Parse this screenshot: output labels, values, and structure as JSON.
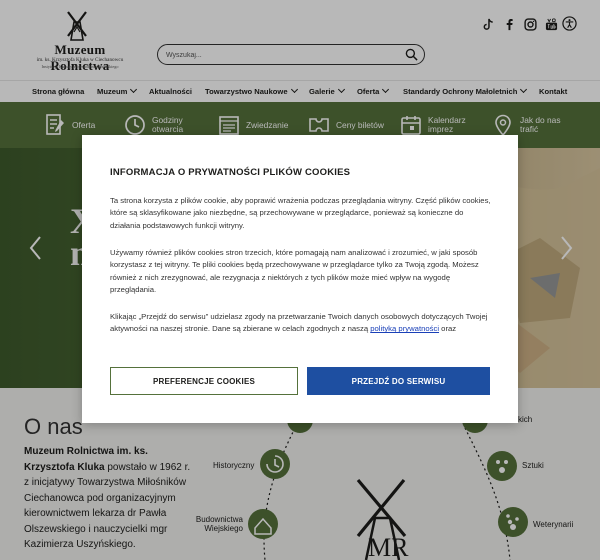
{
  "header": {
    "logo": {
      "title": "Muzeum Rolnictwa",
      "subtitle_line1": "im. ks. Krzysztofa Kluka w Ciechanowcu",
      "subtitle_line2": "Instytucja Kultury Województwa Podlaskiego"
    },
    "search": {
      "placeholder": "Wyszukaj...",
      "value": ""
    },
    "socials": [
      "tiktok-icon",
      "facebook-icon",
      "instagram-icon",
      "youtube-icon"
    ],
    "accessibility_icon": "accessibility-icon"
  },
  "nav": {
    "items": [
      {
        "label": "Strona główna",
        "dropdown": false
      },
      {
        "label": "Muzeum",
        "dropdown": true
      },
      {
        "label": "Aktualności",
        "dropdown": false
      },
      {
        "label": "Towarzystwo Naukowe",
        "dropdown": true
      },
      {
        "label": "Galerie",
        "dropdown": true
      },
      {
        "label": "Oferta",
        "dropdown": true
      },
      {
        "label": "Standardy Ochrony Małoletnich",
        "dropdown": true
      },
      {
        "label": "Kontakt",
        "dropdown": false
      }
    ]
  },
  "quickbar": {
    "items": [
      {
        "icon": "document-icon",
        "label_line1": "Oferta",
        "label_line2": ""
      },
      {
        "icon": "clock-icon",
        "label_line1": "Godziny",
        "label_line2": "otwarcia"
      },
      {
        "icon": "list-icon",
        "label_line1": "Zwiedzanie",
        "label_line2": ""
      },
      {
        "icon": "ticket-icon",
        "label_line1": "Ceny biletów",
        "label_line2": ""
      },
      {
        "icon": "calendar-icon",
        "label_line1": "Kalendarz",
        "label_line2": "imprez"
      },
      {
        "icon": "location-pin-icon",
        "label_line1": "Jak do nas",
        "label_line2": "trafić"
      }
    ]
  },
  "hero": {
    "line1_partial": "X",
    "line2_partial": "m"
  },
  "about": {
    "title": "O nas",
    "bold": "Muzeum Rolnictwa im. ks. Krzysztofa Kluka",
    "text": " powstało w 1962 r. z inicjatywy Towarzystwa Miłośników Ciechanowca pod organizacyjnym kierownictwem lekarza dr Pawła Olszewskiego i nauczycielki mgr Kazimierza Uszyńskiego."
  },
  "diagram": {
    "labels_left": [
      "Historyczny",
      "Budownictwa Wiejskiego"
    ],
    "labels_right": [
      "kich",
      "Sztuki",
      "Weterynarii"
    ],
    "center_letters": "MR"
  },
  "cookie": {
    "title": "INFORMACJA O PRYWATNOŚCI PLIKÓW COOKIES",
    "p1": "Ta strona korzysta z plików cookie, aby poprawić wrażenia podczas przeglądania witryny. Część plików cookies, które są sklasyfikowane jako niezbędne, są przechowywane w przeglądarce, ponieważ są konieczne do działania podstawowych funkcji witryny.",
    "p2": "Używamy również plików cookies stron trzecich, które pomagają nam analizować i zrozumieć, w jaki sposób korzystasz z tej witryny. Te pliki cookies będą przechowywane w przeglądarce tylko za Twoją zgodą. Możesz również z nich zrezygnować, ale rezygnacja z niektórych z tych plików może mieć wpływ na wygodę przeglądania.",
    "p3_before": "Klikając „Przejdź do serwisu” udzielasz zgody na przetwarzanie Twoich danych osobowych dotyczących Twojej aktywności na naszej stronie. Dane są zbierane w celach zgodnych z naszą ",
    "p3_link": "polityką prywatności",
    "p3_after": " oraz",
    "btn_preferences": "PREFERENCJE COOKIES",
    "btn_go": "PRZEJDŹ DO SERWISU"
  },
  "colors": {
    "brand_green": "#55713b",
    "primary_blue": "#1e4fa1",
    "link_blue": "#1a40b8"
  }
}
